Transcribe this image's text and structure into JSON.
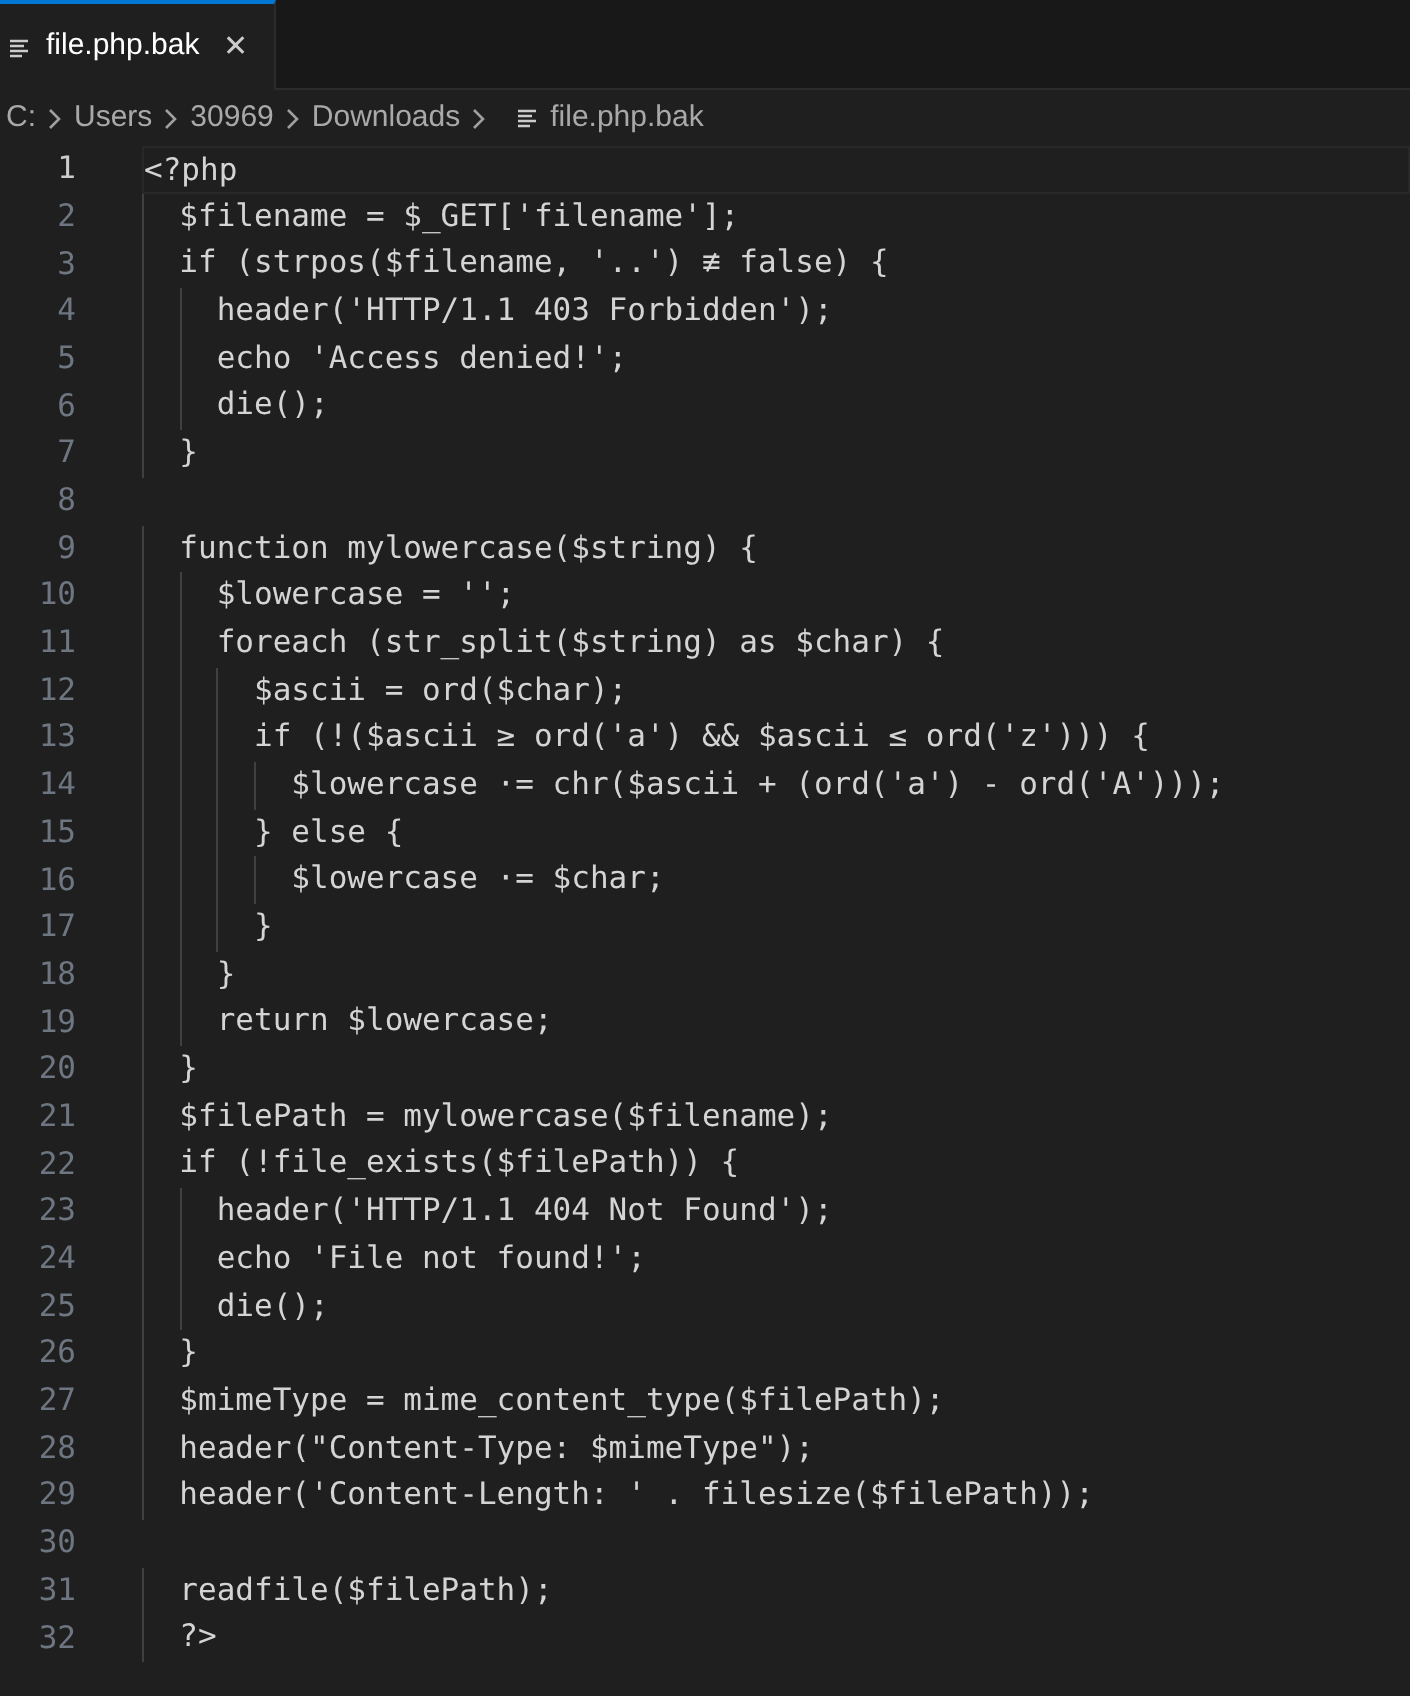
{
  "tabs": [
    {
      "label": "file.php.bak",
      "selected": true,
      "close": "✕"
    }
  ],
  "breadcrumb": [
    {
      "label": "C:",
      "kind": "folder"
    },
    {
      "label": "Users",
      "kind": "folder"
    },
    {
      "label": "30969",
      "kind": "folder"
    },
    {
      "label": "Downloads",
      "kind": "folder"
    },
    {
      "label": "file.php.bak",
      "kind": "file"
    }
  ],
  "lines": [
    {
      "number": "1",
      "code": "<?php",
      "current": true
    },
    {
      "number": "2",
      "code": "  $filename = $_GET['filename'];",
      "current": false
    },
    {
      "number": "3",
      "code": "  if (strpos($filename, '..') ≢ false) {",
      "current": false
    },
    {
      "number": "4",
      "code": "    header('HTTP/1.1 403 Forbidden');",
      "current": false
    },
    {
      "number": "5",
      "code": "    echo 'Access denied!';",
      "current": false
    },
    {
      "number": "6",
      "code": "    die();",
      "current": false
    },
    {
      "number": "7",
      "code": "  }",
      "current": false
    },
    {
      "number": "8",
      "current": false
    },
    {
      "number": "9",
      "code": "  function mylowercase($string) {",
      "current": false
    },
    {
      "number": "10",
      "code": "    $lowercase = '';",
      "current": false
    },
    {
      "number": "11",
      "code": "    foreach (str_split($string) as $char) {",
      "current": false
    },
    {
      "number": "12",
      "code": "      $ascii = ord($char);",
      "current": false
    },
    {
      "number": "13",
      "code": "      if (!($ascii ≥ ord('a') && $ascii ≤ ord('z'))) {",
      "current": false
    },
    {
      "number": "14",
      "code": "        $lowercase ·= chr($ascii + (ord('a') - ord('A')));",
      "current": false
    },
    {
      "number": "15",
      "code": "      } else {",
      "current": false
    },
    {
      "number": "16",
      "code": "        $lowercase ·= $char;",
      "current": false
    },
    {
      "number": "17",
      "code": "      }",
      "current": false
    },
    {
      "number": "18",
      "code": "    }",
      "current": false
    },
    {
      "number": "19",
      "code": "    return $lowercase;",
      "current": false
    },
    {
      "number": "20",
      "code": "  }",
      "current": false
    },
    {
      "number": "21",
      "code": "  $filePath = mylowercase($filename);",
      "current": false
    },
    {
      "number": "22",
      "code": "  if (!file_exists($filePath)) {",
      "current": false
    },
    {
      "number": "23",
      "code": "    header('HTTP/1.1 404 Not Found');",
      "current": false
    },
    {
      "number": "24",
      "code": "    echo 'File not found!';",
      "current": false
    },
    {
      "number": "25",
      "code": "    die();",
      "current": false
    },
    {
      "number": "26",
      "code": "  }",
      "current": false
    },
    {
      "number": "27",
      "code": "  $mimeType = mime_content_type($filePath);",
      "current": false
    },
    {
      "number": "28",
      "code": "  header(\"Content-Type: $mimeType\");",
      "current": false
    },
    {
      "number": "29",
      "code": "  header('Content-Length: ' . filesize($filePath));",
      "current": false
    },
    {
      "number": "30",
      "current": false
    },
    {
      "number": "31",
      "code": "  readfile($filePath);",
      "current": false
    },
    {
      "number": "32",
      "code": "  ?>",
      "current": false
    }
  ]
}
